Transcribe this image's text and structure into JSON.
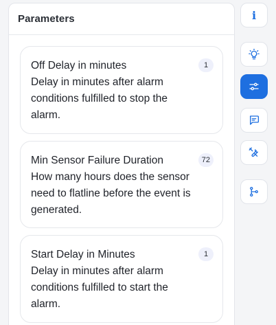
{
  "panel": {
    "title": "Parameters",
    "params": [
      {
        "name": "Off Delay in minutes",
        "description": "Delay in minutes after alarm conditions fulfilled to stop the alarm.",
        "value": "1"
      },
      {
        "name": "Min Sensor Failure Duration",
        "description": "How many hours does the sensor need to flatline before the event is generated.",
        "value": "72"
      },
      {
        "name": "Start Delay in Minutes",
        "description": "Delay in minutes after alarm conditions fulfilled to start the alarm.",
        "value": "1"
      }
    ]
  },
  "toolbar": {
    "info_glyph": "i",
    "items": [
      {
        "icon": "info-icon"
      },
      {
        "icon": "lightbulb-icon"
      },
      {
        "icon": "sliders-icon",
        "active": true
      },
      {
        "icon": "chat-icon"
      },
      {
        "icon": "tools-icon"
      },
      {
        "icon": "flow-icon"
      }
    ],
    "accent_color": "#1e6fe0"
  }
}
